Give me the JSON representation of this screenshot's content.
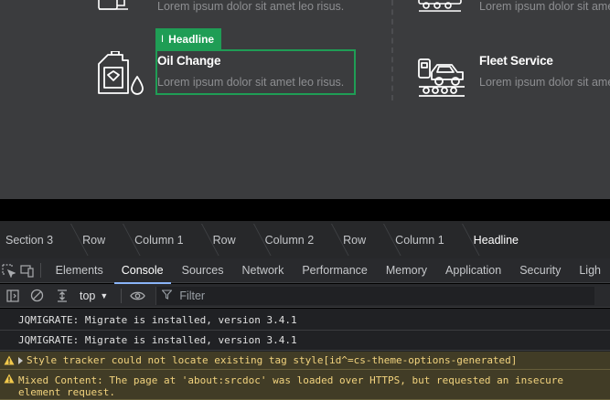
{
  "canvas": {
    "top_left_desc": "Lorem ipsum dolor sit amet leo risus.",
    "top_right_desc": "Lorem ipsum dolor sit amet leo risus.",
    "oil_change": {
      "title": "Oil Change",
      "desc": "Lorem ipsum dolor sit amet leo risus."
    },
    "fleet_service": {
      "title": "Fleet Service",
      "desc": "Lorem ipsum dolor sit amet leo risus."
    },
    "badge": {
      "label": "Headline",
      "icon": "text-cursor-icon"
    }
  },
  "breadcrumbs": [
    "Section 3",
    "Row",
    "Column 1",
    "Row",
    "Column 2",
    "Row",
    "Column 1",
    "Headline"
  ],
  "devtools": {
    "tabs": [
      "Elements",
      "Console",
      "Sources",
      "Network",
      "Performance",
      "Memory",
      "Application",
      "Security",
      "Ligh"
    ],
    "active_tab": "Console",
    "context": "top",
    "filter_placeholder": "Filter"
  },
  "console": {
    "messages": [
      {
        "level": "info",
        "text": "JQMIGRATE: Migrate is installed, version 3.4.1"
      },
      {
        "level": "info",
        "text": "JQMIGRATE: Migrate is installed, version 3.4.1"
      },
      {
        "level": "warning",
        "text": "Style tracker could not locate existing tag style[id^=cs-theme-options-generated]"
      },
      {
        "level": "warning",
        "text": "Mixed Content: The page at 'about:srcdoc' was loaded over HTTPS, but requested an insecure element request."
      }
    ]
  },
  "colors": {
    "accent_green": "#1f9d55",
    "active_tab_underline": "#8ab4f8",
    "warning_bg": "#413c26",
    "warning_text": "#f2d37e"
  }
}
